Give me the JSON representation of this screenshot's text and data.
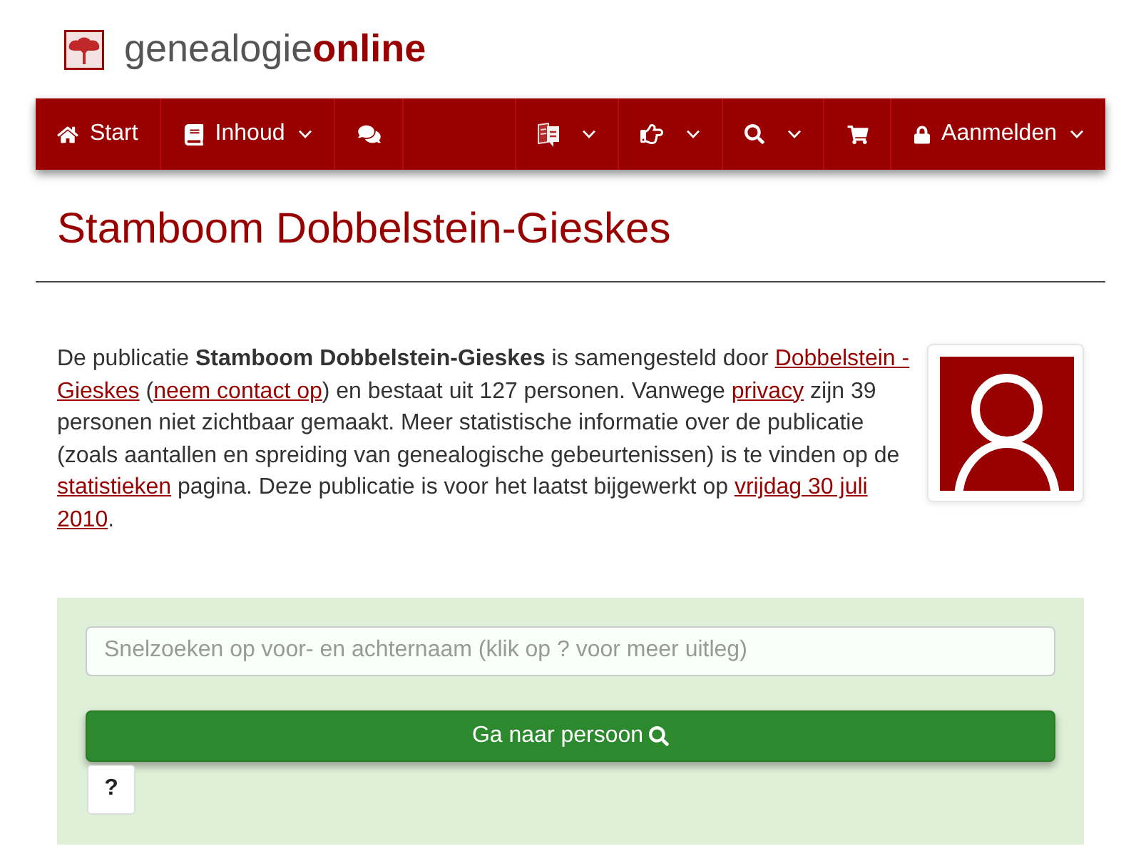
{
  "logo": {
    "text": "genealogie**online**"
  },
  "nav": {
    "left": [
      {
        "label": "Start",
        "dropdown": false
      },
      {
        "label": "Inhoud",
        "dropdown": true
      },
      {
        "dropdown": false
      }
    ],
    "right": [
      {
        "dropdown": true
      },
      {
        "dropdown": true
      },
      {
        "dropdown": true
      },
      {
        "dropdown": false
      },
      {
        "label": "Aanmelden",
        "dropdown": true
      }
    ]
  },
  "page_title": "Stamboom Dobbelstein-Gieskes",
  "description": [
    {
      "kind": "text",
      "text": "De publicatie "
    },
    {
      "kind": "bold",
      "text": "Stamboom Dobbelstein-Gieskes"
    },
    {
      "kind": "text",
      "text": " is samengesteld door "
    },
    {
      "kind": "link",
      "lines": [
        "Dobbelstein -",
        "Gieskes"
      ]
    },
    {
      "kind": "text",
      "text": " ("
    },
    {
      "kind": "link",
      "lines": [
        "neem contact op"
      ]
    },
    {
      "kind": "text",
      "text": ") en bestaat uit 127 personen. Vanwege "
    },
    {
      "kind": "link",
      "lines": [
        "privacy"
      ]
    },
    {
      "kind": "text",
      "text": " zijn 39 personen niet zichtbaar gemaakt. Meer statistische informatie over de publicatie (zoals aantallen en spreiding van genealogische gebeurtenissen) is te vinden op de "
    },
    {
      "kind": "link",
      "lines": [
        "statistieken"
      ]
    },
    {
      "kind": "text",
      "text": " pagina. Deze publicatie is voor het laatst bijgewerkt op "
    },
    {
      "kind": "link",
      "lines": [
        "vrijdag 30 juli",
        "2010"
      ]
    },
    {
      "kind": "text",
      "text": "."
    }
  ],
  "quick_search": {
    "placeholder": "Snelzoeken op voor- en achternaam (klik op ? voor meer uitleg)",
    "button": "Ga naar persoon",
    "help": "?"
  }
}
